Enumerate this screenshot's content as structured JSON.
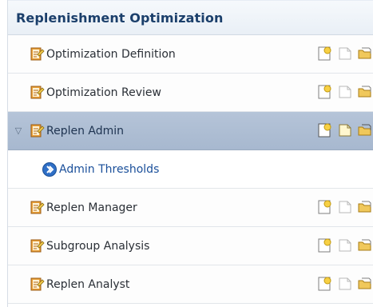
{
  "panel": {
    "title": "Replenishment Optimization",
    "items": [
      {
        "label": "Optimization Definition",
        "expanded": false,
        "selected": false
      },
      {
        "label": "Optimization Review",
        "expanded": false,
        "selected": false
      },
      {
        "label": "Replen Admin",
        "expanded": true,
        "selected": true,
        "children": [
          {
            "label": "Admin Thresholds"
          }
        ]
      },
      {
        "label": "Replen Manager",
        "expanded": false,
        "selected": false
      },
      {
        "label": "Subgroup Analysis",
        "expanded": false,
        "selected": false
      },
      {
        "label": "Replen Analyst",
        "expanded": false,
        "selected": false
      }
    ],
    "disclosure_glyph": "▽"
  },
  "icons": {
    "item": "task-list-icon",
    "new": "new-document-icon",
    "blank": "blank-document-icon",
    "open": "open-folder-icon",
    "link": "circle-arrow-right-icon"
  },
  "colors": {
    "header_text": "#1b3f6b",
    "selected_row": "#b0c0d6",
    "link_text": "#1a4f9a"
  }
}
